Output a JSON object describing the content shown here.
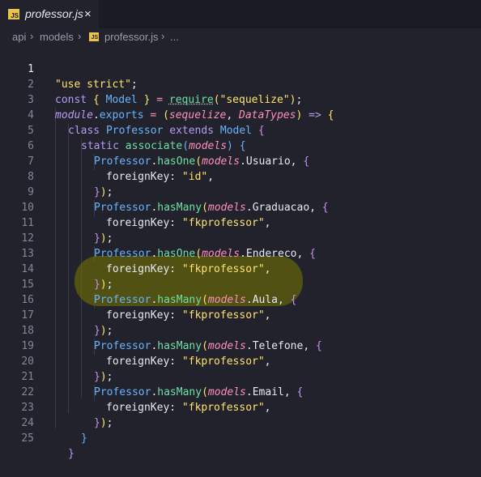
{
  "tab": {
    "icon_label": "JS",
    "filename": "professor.js",
    "close": "×"
  },
  "breadcrumb": {
    "items": [
      "api",
      "models",
      "professor.js",
      "..."
    ],
    "separator": "›"
  },
  "editor": {
    "line_numbers": [
      "1",
      "2",
      "3",
      "4",
      "5",
      "6",
      "7",
      "8",
      "9",
      "10",
      "11",
      "12",
      "13",
      "14",
      "15",
      "16",
      "17",
      "18",
      "19",
      "20",
      "21",
      "22",
      "23",
      "24",
      "25"
    ],
    "active_line": "1",
    "highlighted_lines": [
      "15",
      "16",
      "17"
    ],
    "lines": [
      "\"use strict\";",
      "const { Model } = require(\"sequelize\");",
      "module.exports = (sequelize, DataTypes) => {",
      "class Professor extends Model {",
      "static associate(models) {",
      "Professor.hasOne(models.Usuario, {",
      "foreignKey: \"id\",",
      "});",
      "Professor.hasMany(models.Graduacao, {",
      "foreignKey: \"fkprofessor\",",
      "});",
      "Professor.hasOne(models.Endereco, {",
      "foreignKey: \"fkprofessor\",",
      "});",
      "Professor.hasMany(models.Aula, {",
      "foreignKey: \"fkprofessor\",",
      "});",
      "Professor.hasMany(models.Telefone, {",
      "foreignKey: \"fkprofessor\",",
      "});",
      "Professor.hasMany(models.Email, {",
      "foreignKey: \"fkprofessor\",",
      "});",
      "}",
      "}"
    ]
  },
  "colors": {
    "background": "#22222c",
    "keyword": "#b69cf4",
    "class": "#68b4ff",
    "function": "#6ee0a4",
    "string": "#ffe36e",
    "parameter": "#ff8fb8",
    "highlight": "#787800"
  }
}
